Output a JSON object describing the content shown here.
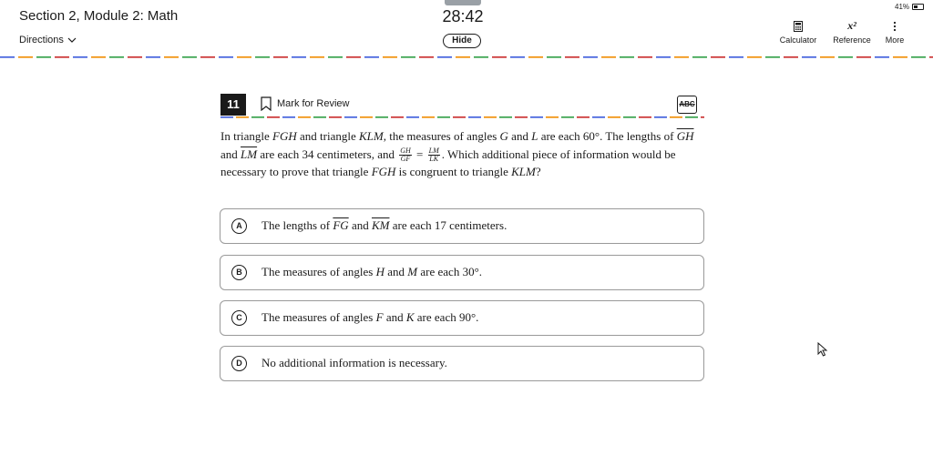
{
  "header": {
    "section_title": "Section 2, Module 2: Math",
    "directions_label": "Directions",
    "timer": "28:42",
    "hide_label": "Hide",
    "battery": "41%",
    "tools": {
      "calculator": "Calculator",
      "reference": "Reference",
      "reference_icon_text": "x²",
      "more": "More"
    }
  },
  "question": {
    "number": "11",
    "mark_for_review": "Mark for Review",
    "abc_label": "ABC",
    "stem": {
      "p1": "In triangle ",
      "fgh": "FGH",
      "p2": " and triangle ",
      "klm": "KLM",
      "p3": ", the measures of angles ",
      "g": "G",
      "p4": " and ",
      "l": "L",
      "p5": " are each 60°. The lengths of ",
      "gh": "GH",
      "p6": " and ",
      "lm": "LM",
      "p7": " are each 34 centimeters, and ",
      "frac1_num": "GH",
      "frac1_den": "GF",
      "eq": " = ",
      "frac2_num": "LM",
      "frac2_den": "LK",
      "p8": ". Which additional piece of information would be necessary to prove that triangle ",
      "fgh2": "FGH",
      "p9": " is congruent to triangle ",
      "klm2": "KLM",
      "p10": "?"
    },
    "choices": [
      {
        "letter": "A",
        "pre": "The lengths of ",
        "seg1": "FG",
        "mid": " and ",
        "seg2": "KM",
        "post": " are each 17 centimeters."
      },
      {
        "letter": "B",
        "pre": "The measures of angles ",
        "v1": "H",
        "mid": " and ",
        "v2": "M",
        "post": " are each 30°."
      },
      {
        "letter": "C",
        "pre": "The measures of angles ",
        "v1": "F",
        "mid": " and ",
        "v2": "K",
        "post": " are each 90°."
      },
      {
        "letter": "D",
        "text": "No additional information is necessary."
      }
    ]
  },
  "colors": {
    "dash_palette": [
      "#3b5bdb",
      "#f08c00",
      "#2f9e44",
      "#c92a2a"
    ],
    "text": "#1a1a1a",
    "border": "#9a9a9a"
  }
}
